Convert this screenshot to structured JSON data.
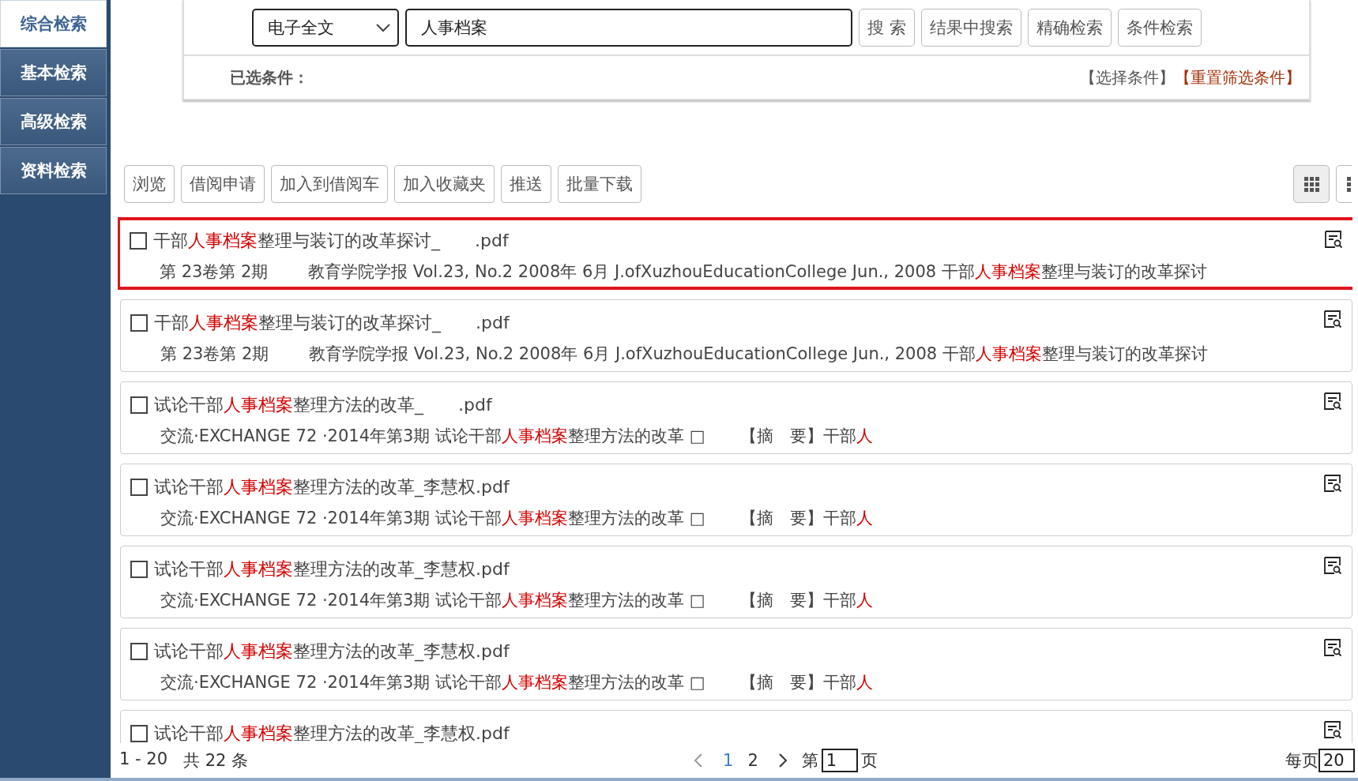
{
  "sidebar": {
    "tabs": [
      {
        "label": "综合检索",
        "selected": true
      },
      {
        "label": "基本检索",
        "selected": false
      },
      {
        "label": "高级检索",
        "selected": false
      },
      {
        "label": "资料检索",
        "selected": false
      }
    ]
  },
  "search": {
    "field_select": "电子全文",
    "query": "人事档案",
    "buttons": [
      "搜 索",
      "结果中搜索",
      "精确检索",
      "条件检索"
    ],
    "conditions_label": "已选条件：",
    "links": [
      {
        "label": "【选择条件】",
        "kind": "normal"
      },
      {
        "label": "【重置筛选条件】",
        "kind": "reset"
      }
    ]
  },
  "toolbar": {
    "buttons": [
      "浏览",
      "借阅申请",
      "加入到借阅车",
      "加入收藏夹",
      "推送",
      "批量下载"
    ],
    "views": [
      {
        "kind": "grid",
        "selected": true
      },
      {
        "kind": "list",
        "selected": false
      }
    ]
  },
  "results": [
    {
      "selected": true,
      "checked": false,
      "title": [
        {
          "kind": "text",
          "t": "干部"
        },
        {
          "kind": "highlight",
          "t": "人事档案"
        },
        {
          "kind": "text",
          "t": "整理与装订的改革探讨_"
        },
        {
          "kind": "redacted"
        },
        {
          "kind": "text",
          "t": ".pdf"
        }
      ],
      "detail": [
        {
          "kind": "text",
          "t": "第 23卷第 2期 "
        },
        {
          "kind": "redacted"
        },
        {
          "kind": "text",
          "t": "教育学院学报 Vol.23, No.2 2008年 6月 J.ofXuzhouEducationCollege Jun., 2008 干部"
        },
        {
          "kind": "highlight",
          "t": "人事档案"
        },
        {
          "kind": "text",
          "t": "整理与装订的改革探讨"
        }
      ]
    },
    {
      "selected": false,
      "checked": false,
      "title": [
        {
          "kind": "text",
          "t": "干部"
        },
        {
          "kind": "highlight",
          "t": "人事档案"
        },
        {
          "kind": "text",
          "t": "整理与装订的改革探讨_"
        },
        {
          "kind": "redacted"
        },
        {
          "kind": "text",
          "t": ".pdf"
        }
      ],
      "detail": [
        {
          "kind": "text",
          "t": "第 23卷第 2期 "
        },
        {
          "kind": "redacted"
        },
        {
          "kind": "text",
          "t": "教育学院学报 Vol.23, No.2 2008年 6月 J.ofXuzhouEducationCollege Jun., 2008 干部"
        },
        {
          "kind": "highlight",
          "t": "人事档案"
        },
        {
          "kind": "text",
          "t": "整理与装订的改革探讨"
        }
      ]
    },
    {
      "selected": false,
      "checked": false,
      "title": [
        {
          "kind": "text",
          "t": "试论干部"
        },
        {
          "kind": "highlight",
          "t": "人事档案"
        },
        {
          "kind": "text",
          "t": "整理方法的改革_"
        },
        {
          "kind": "redacted"
        },
        {
          "kind": "text",
          "t": ".pdf"
        }
      ],
      "detail": [
        {
          "kind": "text",
          "t": "交流·EXCHANGE 72 ·2014年第3期 试论干部"
        },
        {
          "kind": "highlight",
          "t": "人事档案"
        },
        {
          "kind": "text",
          "t": "整理方法的改革 □"
        },
        {
          "kind": "redacted"
        },
        {
          "kind": "text",
          "t": "【摘　要】干部"
        },
        {
          "kind": "highlight",
          "t": "人"
        }
      ]
    },
    {
      "selected": false,
      "checked": false,
      "title": [
        {
          "kind": "text",
          "t": "试论干部"
        },
        {
          "kind": "highlight",
          "t": "人事档案"
        },
        {
          "kind": "text",
          "t": "整理方法的改革_李慧权.pdf"
        }
      ],
      "detail": [
        {
          "kind": "text",
          "t": "交流·EXCHANGE 72 ·2014年第3期 试论干部"
        },
        {
          "kind": "highlight",
          "t": "人事档案"
        },
        {
          "kind": "text",
          "t": "整理方法的改革 □"
        },
        {
          "kind": "redacted"
        },
        {
          "kind": "text",
          "t": "【摘　要】干部"
        },
        {
          "kind": "highlight",
          "t": "人"
        }
      ]
    },
    {
      "selected": false,
      "checked": false,
      "title": [
        {
          "kind": "text",
          "t": "试论干部"
        },
        {
          "kind": "highlight",
          "t": "人事档案"
        },
        {
          "kind": "text",
          "t": "整理方法的改革_李慧权.pdf"
        }
      ],
      "detail": [
        {
          "kind": "text",
          "t": "交流·EXCHANGE 72 ·2014年第3期 试论干部"
        },
        {
          "kind": "highlight",
          "t": "人事档案"
        },
        {
          "kind": "text",
          "t": "整理方法的改革 □"
        },
        {
          "kind": "redacted"
        },
        {
          "kind": "text",
          "t": "【摘　要】干部"
        },
        {
          "kind": "highlight",
          "t": "人"
        }
      ]
    },
    {
      "selected": false,
      "checked": false,
      "title": [
        {
          "kind": "text",
          "t": "试论干部"
        },
        {
          "kind": "highlight",
          "t": "人事档案"
        },
        {
          "kind": "text",
          "t": "整理方法的改革_李慧权.pdf"
        }
      ],
      "detail": [
        {
          "kind": "text",
          "t": "交流·EXCHANGE 72 ·2014年第3期 试论干部"
        },
        {
          "kind": "highlight",
          "t": "人事档案"
        },
        {
          "kind": "text",
          "t": "整理方法的改革 □"
        },
        {
          "kind": "redacted"
        },
        {
          "kind": "text",
          "t": "【摘　要】干部"
        },
        {
          "kind": "highlight",
          "t": "人"
        }
      ]
    },
    {
      "selected": false,
      "checked": false,
      "title": [
        {
          "kind": "text",
          "t": "试论干部"
        },
        {
          "kind": "highlight",
          "t": "人事档案"
        },
        {
          "kind": "text",
          "t": "整理方法的改革_李慧权.pdf"
        }
      ]
    }
  ],
  "pager": {
    "range": "1 - 20",
    "total": "共 22 条",
    "pages": [
      {
        "label": "1",
        "selected": true
      },
      {
        "label": "2",
        "selected": false
      }
    ],
    "goto_prefix": "第",
    "goto_value": "1",
    "goto_suffix": "页",
    "per_page_label": "每页",
    "per_page_value": "20"
  }
}
